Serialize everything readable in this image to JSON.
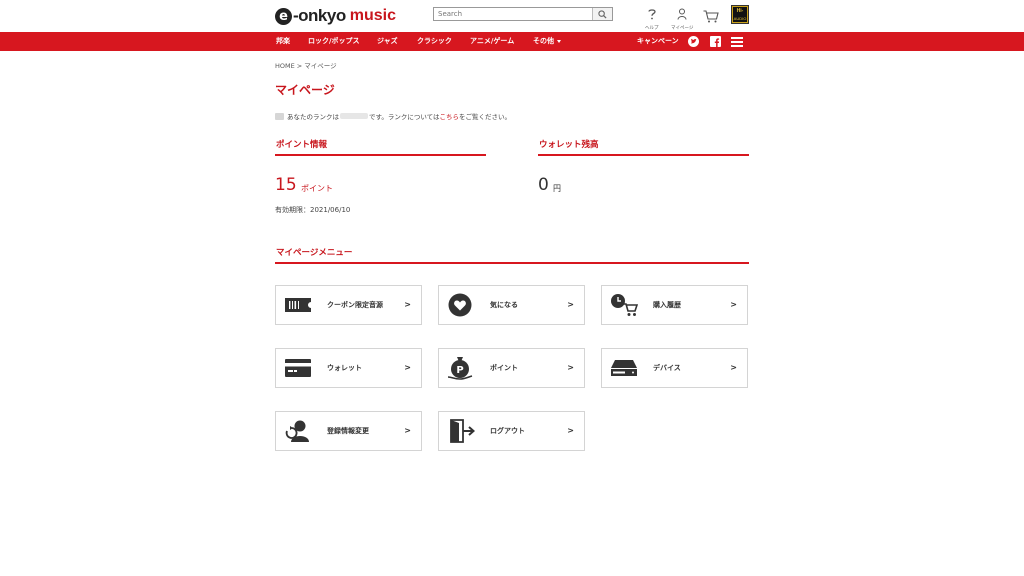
{
  "header": {
    "logo_mark": "e",
    "logo_text_onkyo": "-onkyo",
    "logo_text_music": "music",
    "search_placeholder": "Search",
    "help_label": "ヘルプ",
    "mypage_label": "マイページ",
    "hires_top": "Hi-Res",
    "hires_bottom": "AUDIO"
  },
  "nav": {
    "items": [
      "邦楽",
      "ロック/ポップス",
      "ジャズ",
      "クラシック",
      "アニメ/ゲーム",
      "その他"
    ],
    "campaign": "キャンペーン"
  },
  "breadcrumb": "HOME > マイページ",
  "page_title": "マイページ",
  "rank": {
    "prefix": "あなたのランクは",
    "middle": "です。ランクについては",
    "link": "こちら",
    "suffix": "をご覧ください。"
  },
  "points": {
    "heading": "ポイント情報",
    "value": "15",
    "unit": "ポイント",
    "expiry": "有効期限：2021/06/10"
  },
  "wallet": {
    "heading": "ウォレット残高",
    "value": "0",
    "unit": "円"
  },
  "menu": {
    "heading": "マイページメニュー",
    "arrow": ">",
    "items": [
      {
        "label": "クーポン限定音源",
        "icon": "ticket-icon"
      },
      {
        "label": "気になる",
        "icon": "heart-icon"
      },
      {
        "label": "購入履歴",
        "icon": "cart-history-icon"
      },
      {
        "label": "ウォレット",
        "icon": "credit-card-icon"
      },
      {
        "label": "ポイント",
        "icon": "point-bag-icon"
      },
      {
        "label": "デバイス",
        "icon": "device-icon"
      },
      {
        "label": "登録情報変更",
        "icon": "user-edit-icon"
      },
      {
        "label": "ログアウト",
        "icon": "logout-icon"
      }
    ]
  },
  "colors": {
    "brand_red": "#d7171f",
    "text": "#333333"
  }
}
